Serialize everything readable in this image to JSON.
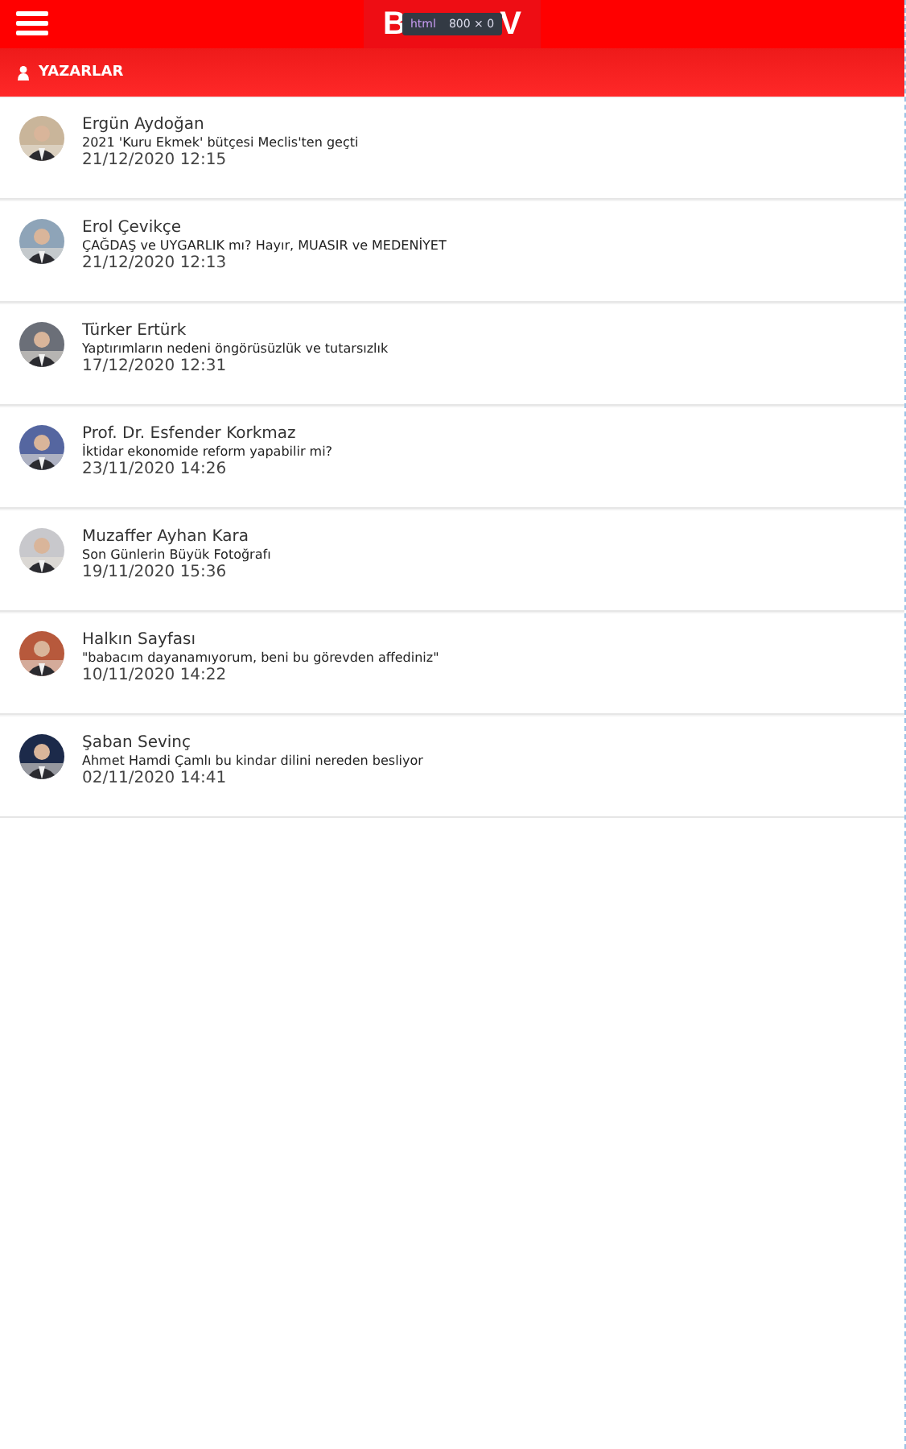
{
  "header": {
    "logo_start": "B",
    "logo_end": "V",
    "tooltip": {
      "tag": "html",
      "size": "800 × 0"
    }
  },
  "section": {
    "title": "YAZARLAR"
  },
  "authors": [
    {
      "name": "Ergün Aydoğan",
      "title": "2021 'Kuru Ekmek' bütçesi Meclis'ten geçti",
      "date": "21/12/2020 12:15"
    },
    {
      "name": "Erol Çevikçe",
      "title": "ÇAĞDAŞ ve UYGARLIK mı? Hayır, MUASIR ve MEDENİYET",
      "date": "21/12/2020 12:13"
    },
    {
      "name": "Türker Ertürk",
      "title": "Yaptırımların nedeni öngörüsüzlük ve tutarsızlık",
      "date": "17/12/2020 12:31"
    },
    {
      "name": "Prof. Dr. Esfender Korkmaz",
      "title": "İktidar ekonomide reform yapabilir mi?",
      "date": "23/11/2020 14:26"
    },
    {
      "name": "Muzaffer Ayhan Kara",
      "title": "Son Günlerin Büyük Fotoğrafı",
      "date": "19/11/2020 15:36"
    },
    {
      "name": "Halkın Sayfası",
      "title": "\"babacım dayanamıyorum, beni bu görevden affediniz\"",
      "date": "10/11/2020 14:22"
    },
    {
      "name": "Şaban Sevinç",
      "title": "Ahmet Hamdi Çamlı bu kindar dilini nereden besliyor",
      "date": "02/11/2020 14:41"
    }
  ]
}
